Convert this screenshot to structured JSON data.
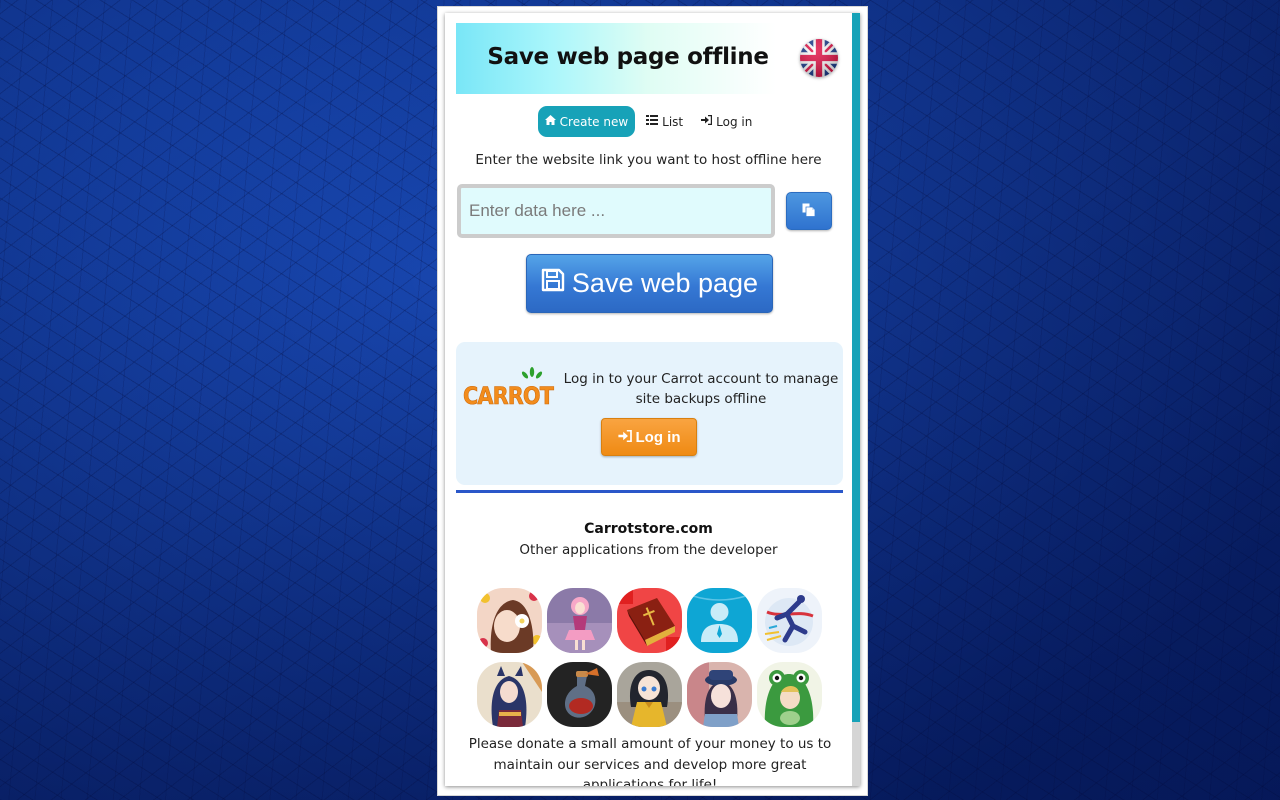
{
  "header": {
    "title": "Save web page offline",
    "language_flag": "uk-flag-icon"
  },
  "nav": {
    "items": [
      {
        "label": "Create new",
        "icon": "home-icon",
        "active": true
      },
      {
        "label": "List",
        "icon": "list-icon",
        "active": false
      },
      {
        "label": "Log in",
        "icon": "sign-in-icon",
        "active": false
      }
    ]
  },
  "form": {
    "instruction": "Enter the website link you want to host offline here",
    "url_value": "",
    "url_placeholder": "Enter data here ...",
    "paste_icon": "paste-icon",
    "save_label": "Save web page",
    "save_icon": "floppy-disk-icon"
  },
  "carrot": {
    "logo_text": "CARROT",
    "message": "Log in to your Carrot account to manage site backups offline",
    "login_label": "Log in",
    "login_icon": "sign-in-icon"
  },
  "store": {
    "title": "Carrotstore.com",
    "subtitle": "Other applications from the developer",
    "apps": [
      {
        "name": "girl-flower-app"
      },
      {
        "name": "anime-pink-girl-app"
      },
      {
        "name": "bible-app"
      },
      {
        "name": "contact-person-app"
      },
      {
        "name": "runner-app"
      },
      {
        "name": "anime-cat-girl-app"
      },
      {
        "name": "potion-bottle-app"
      },
      {
        "name": "anime-yellow-dress-app"
      },
      {
        "name": "anime-police-girl-app"
      },
      {
        "name": "frog-costume-app"
      }
    ]
  },
  "donate": {
    "text": "Please donate a small amount of your money to us to maintain our services and develop more great applications for life!"
  },
  "colors": {
    "accent_teal": "#17a2b8",
    "primary_blue": "#3578d4",
    "login_orange": "#ef8a13",
    "divider_blue": "#2a57c9",
    "panel_bg": "#e6f3fc",
    "input_bg": "#e0fbfd"
  }
}
